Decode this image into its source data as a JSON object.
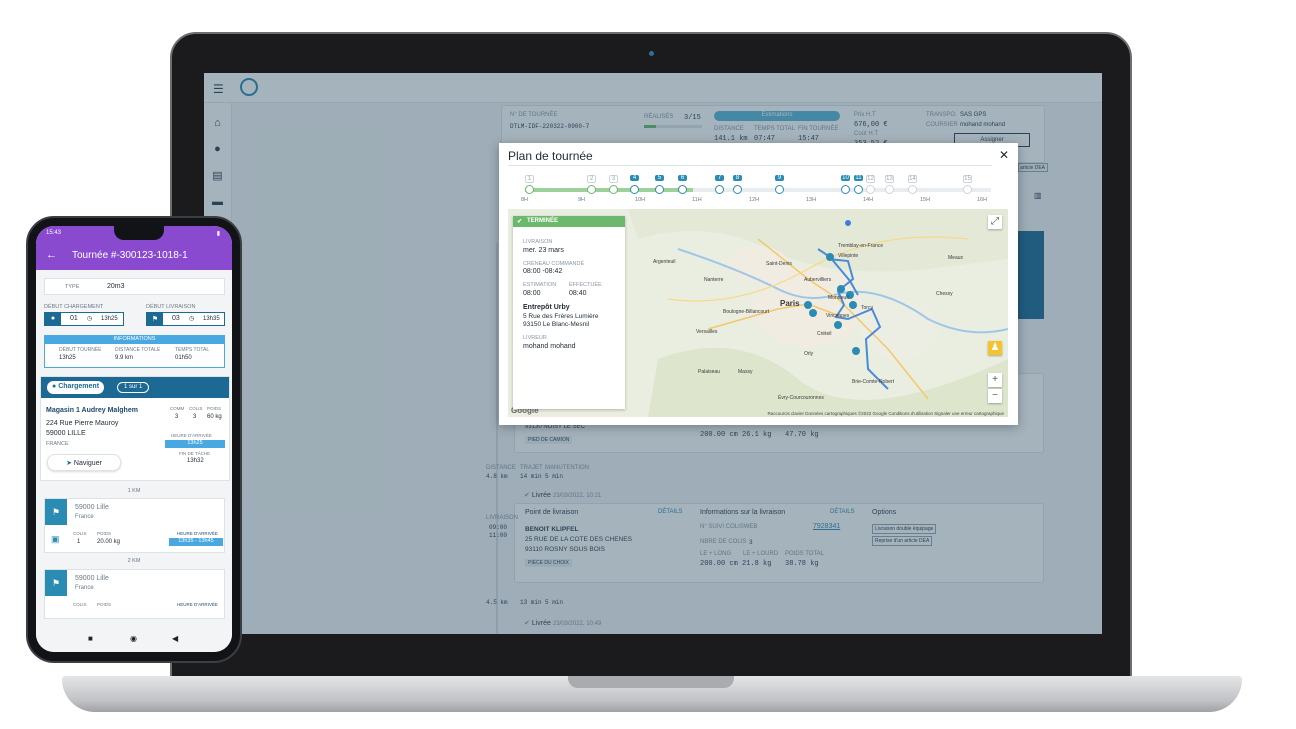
{
  "laptop": {
    "bg": {
      "tour_label": "N° DE TOURNÉE",
      "tour_id": "DTLM-IDF-220322-0900-7",
      "done_label": "RÉALISÉS",
      "done_count": "3/15",
      "estimations_label": "Estimations",
      "distance_label": "DISTANCE",
      "distance": "141.1 km",
      "time_label": "TEMPS TOTAL",
      "time": "07:47",
      "end_label": "FIN TOURNÉE",
      "end": "15:47",
      "price_label": "Prix H.T",
      "price": "676,00 €",
      "cost_label": "Coût H.T",
      "cost": "353,52 €",
      "transpo_label": "TRANSPO.",
      "transpo": "SAS GPS",
      "courier_label": "COURSIER",
      "courier": "mohand mohand",
      "assign_btn": "Assigner",
      "article_dea": "article DEA",
      "city1": "93130 NOISY LE SEC",
      "foot_tag1": "PIED DE CAMION",
      "dims1": "200.00 cm 26.1 kg",
      "weight1": "47.70 kg",
      "left_distance_label": "DISTANCE",
      "left_distance": "4.8 km",
      "trajet_label": "TRAJET",
      "trajet": "14 min",
      "manut_label": "MANUTENTION",
      "manut": "5 min",
      "delivered1": "Livrée",
      "delivered1_date": "23/03/2022, 10:21",
      "point_label": "Point de livraison",
      "details": "DÉTAILS",
      "info_label": "Informations sur la livraison",
      "options_label": "Options",
      "name2": "BENOIT KLIPFEL",
      "addr2": "25 RUE DE LA COTE DES CHENES",
      "city2": "93110 ROSNY SOUS BOIS",
      "floor_tag2": "PIÈCE DU CHOIX",
      "colisweb_label": "N° SUIVI COLISWEB",
      "colisweb": "7928341",
      "nbre_label": "NBRE DE COLIS",
      "nbre": "3",
      "long_label": "LE + LONG",
      "lourd_label": "LE + LOURD",
      "poids_label": "POIDS TOTAL",
      "dims2": "200.00 cm 21.8 kg",
      "weight2": "38.78 kg",
      "opt1": "Livraison double équipage",
      "opt2": "Reprise d'un article DEA",
      "left_livraison": "LIVRAISON",
      "left_time1": "09:00",
      "left_time2": "11:00",
      "left_distance2": "4.5 km",
      "trajet2": "13 min",
      "manut2": "5 min",
      "delivered2": "Livrée",
      "delivered2_date": "23/03/2022, 10:49"
    },
    "modal": {
      "title": "Plan de tournée",
      "timeline_hours": [
        "8H",
        "9H",
        "10H",
        "11H",
        "12H",
        "13H",
        "14H",
        "15H",
        "16H"
      ],
      "stops": [
        "1",
        "2",
        "3",
        "4",
        "5",
        "6",
        "7",
        "8",
        "9",
        "10",
        "11",
        "12",
        "13",
        "14",
        "15"
      ],
      "status": "TERMINÉE",
      "livraison_label": "LIVRAISON",
      "livraison_date": "mer. 23 mars",
      "creneau_label": "CRÉNEAU COMMANDÉ",
      "creneau": "08:00 -08:42",
      "estimation_label": "ESTIMATION",
      "estimation": "08:00",
      "effectuee_label": "EFFECTUÉE",
      "effectuee": "08:40",
      "place_name": "Entrepôt Urby",
      "place_addr1": "5 Rue des Frères Lumière",
      "place_addr2": "93150 Le Blanc-Mesnil",
      "livreur_label": "LIVREUR",
      "livreur": "mohand mohand",
      "map_places": [
        "Argenteuil",
        "Saint-Denis",
        "Paris",
        "Versailles",
        "Créteil",
        "Torcy",
        "Chessy",
        "Orly",
        "Évry-Courcouronnes",
        "Brie-Comte-Robert",
        "Boulogne-Billancourt",
        "Aubervilliers",
        "Villepinte",
        "Tremblay-en-France",
        "Meaux",
        "Nanterre",
        "Montreuil",
        "Massy",
        "Palaiseau",
        "Vincennes"
      ],
      "attribution": "Raccourcis clavier   Données cartographiques ©2022 Google   Conditions d'utilisation   Signaler une erreur cartographique",
      "google": "Google"
    }
  },
  "phone": {
    "time": "15:43",
    "title": "Tournée #-300123-1018-1",
    "type_label": "TYPE",
    "type": "20m3",
    "debut_chargement_label": "DÉBUT CHARGEMENT",
    "debut_chargement_num": "01",
    "debut_chargement_time": "13h25",
    "debut_livraison_label": "DÉBUT LIVRAISON",
    "debut_livraison_num": "03",
    "debut_livraison_time": "13h35",
    "informations_label": "INFORMATIONS",
    "debut_tournee_label": "DÉBUT TOURNÉE",
    "debut_tournee": "13h25",
    "distance_totale_label": "DISTANCE TOTALE",
    "distance_totale": "9.9 km",
    "temps_total_label": "TEMPS TOTAL",
    "temps_total": "01h50",
    "chargement": "Chargement",
    "chargement_count": "1 sur 1",
    "shop_name": "Magasin 1 Audrey Malghem",
    "shop_addr": "224 Rue Pierre Mauroy",
    "shop_city": "59000 LILLE",
    "shop_country": "FRANCE",
    "comm_label": "COMM",
    "comm": "3",
    "colis_label": "COLIS",
    "colis": "3",
    "poids_label": "POIDS",
    "poids": "60 kg",
    "heure_arrivee_label": "HEURE D'ARRIVÉE",
    "heure_arrivee": "13h25",
    "fin_tache_label": "FIN DE TÂCHE",
    "fin_tache": "13h32",
    "navigate": "Naviguer",
    "km1": "1 KM",
    "stop1_city": "59000 Lille",
    "stop1_country": "France",
    "stop1_colis_label": "COLIS",
    "stop1_colis": "1",
    "stop1_poids_label": "POIDS",
    "stop1_poids": "20.00 kg",
    "stop1_arrivee_label": "HEURE D'ARRIVÉE",
    "stop1_arrivee": "13h35 - 13h45",
    "km2": "2 KM",
    "stop2_city": "59000 Lille",
    "stop2_country": "France",
    "stop2_colis_label": "COLIS",
    "stop2_poids_label": "POIDS",
    "stop2_arrivee_label": "HEURE D'ARRIVÉE"
  },
  "colors": {
    "phone_header": "#8a4ad0",
    "primary_blue": "#1c6a94",
    "accent_blue": "#2a8bb3",
    "success_green": "#6cb86c"
  }
}
